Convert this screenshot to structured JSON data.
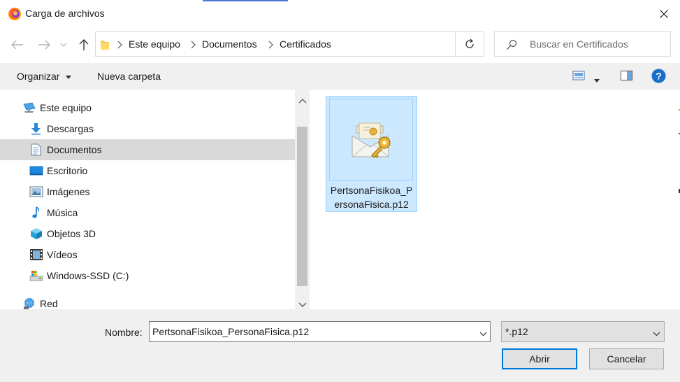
{
  "window": {
    "title": "Carga de archivos",
    "close_label": "×"
  },
  "navigation": {
    "breadcrumbs": [
      "Este equipo",
      "Documentos",
      "Certificados"
    ],
    "search_placeholder": "Buscar en Certificados"
  },
  "toolbar": {
    "organize_label": "Organizar",
    "new_folder_label": "Nueva carpeta"
  },
  "sidebar": {
    "items": [
      {
        "label": "Este equipo",
        "icon": "computer-icon",
        "selected": false
      },
      {
        "label": "Descargas",
        "icon": "downloads-icon",
        "selected": false
      },
      {
        "label": "Documentos",
        "icon": "documents-icon",
        "selected": true
      },
      {
        "label": "Escritorio",
        "icon": "desktop-icon",
        "selected": false
      },
      {
        "label": "Imágenes",
        "icon": "pictures-icon",
        "selected": false
      },
      {
        "label": "Música",
        "icon": "music-icon",
        "selected": false
      },
      {
        "label": "Objetos 3D",
        "icon": "3d-objects-icon",
        "selected": false
      },
      {
        "label": "Vídeos",
        "icon": "videos-icon",
        "selected": false
      },
      {
        "label": "Windows-SSD (C:)",
        "icon": "drive-icon",
        "selected": false
      },
      {
        "label": "Red",
        "icon": "network-icon",
        "selected": false
      }
    ]
  },
  "files": [
    {
      "name": "PertsonaFisikoa_PersonaFisica.p12",
      "icon": "certificate-icon",
      "selected": true
    }
  ],
  "footer": {
    "name_label": "Nombre:",
    "name_value": "PertsonaFisikoa_PersonaFisica.p12",
    "file_type": "*.p12",
    "open_label": "Abrir",
    "cancel_label": "Cancelar"
  },
  "colors": {
    "accent": "#0078d7",
    "selection_fill": "#cce8ff",
    "selection_border": "#99d1ff",
    "panel_bg": "#f0f0f0"
  }
}
